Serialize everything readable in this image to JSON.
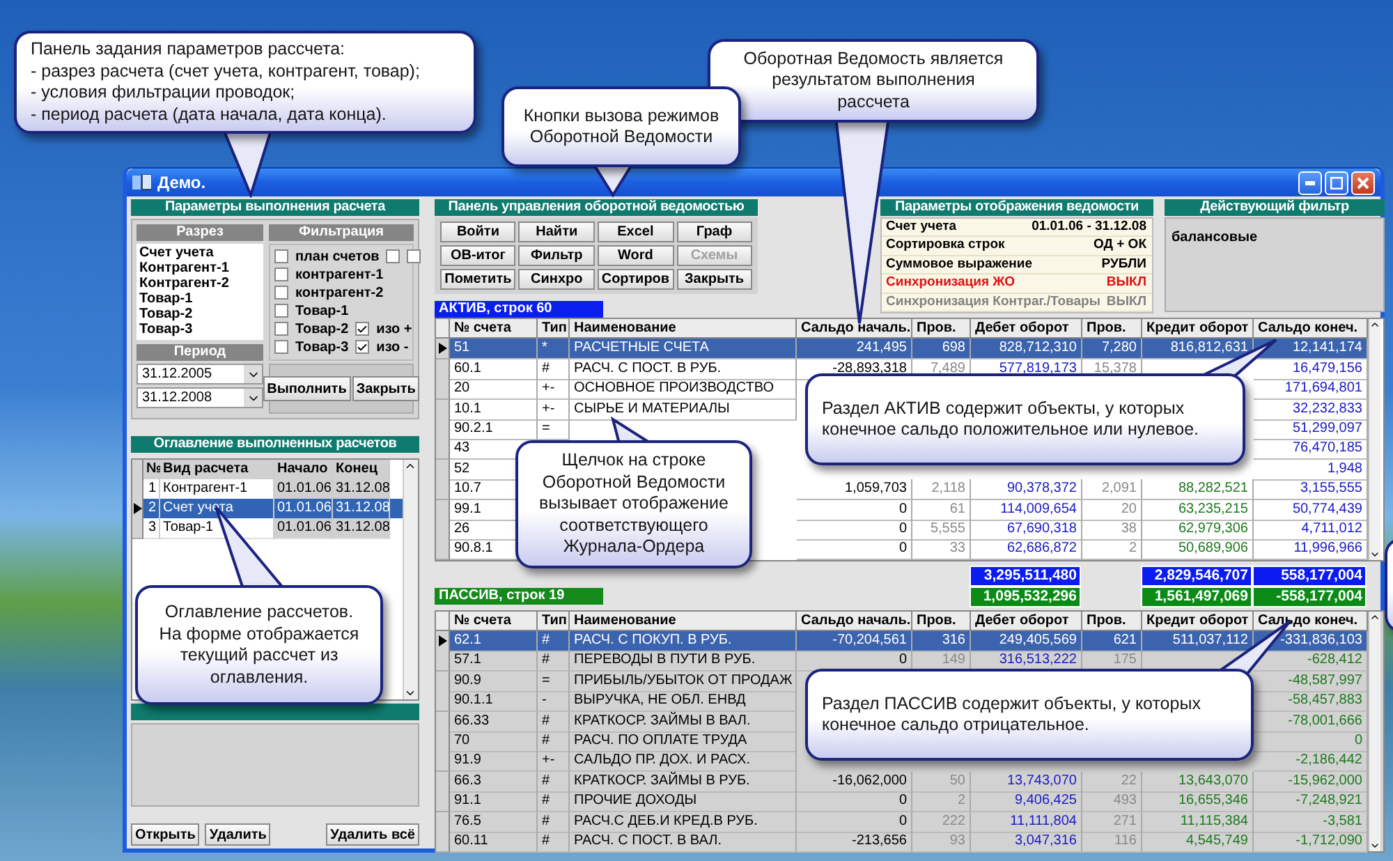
{
  "window": {
    "title": "Демо."
  },
  "calc_params": {
    "title": "Параметры выполнения расчета",
    "section": {
      "title": "Разрез",
      "items": [
        "Счет учета",
        "Контрагент-1",
        "Контрагент-2",
        "Товар-1",
        "Товар-2",
        "Товар-3"
      ]
    },
    "period": {
      "title": "Период",
      "start": "31.12.2005",
      "end": "31.12.2008"
    },
    "filter": {
      "title": "Фильтрация",
      "options": [
        {
          "label": "план счетов",
          "checked": false,
          "sub": [
            {
              "checked": false
            },
            {
              "checked": false
            }
          ]
        },
        {
          "label": "контрагент-1",
          "checked": false
        },
        {
          "label": "контрагент-2",
          "checked": false
        },
        {
          "label": "Товар-1",
          "checked": false
        },
        {
          "label": "Товар-2",
          "checked": false,
          "sub": [
            {
              "checked": true,
              "label": "изо +"
            }
          ]
        },
        {
          "label": "Товар-3",
          "checked": false,
          "sub": [
            {
              "checked": true,
              "label": "изо -"
            }
          ]
        }
      ]
    },
    "buttons": [
      "Выполнить",
      "Закрыть"
    ]
  },
  "toc": {
    "title": "Оглавление выполненных  расчетов",
    "columns": [
      "№",
      "Вид расчета",
      "Начало",
      "Конец"
    ],
    "rows": [
      {
        "cells": [
          "1",
          "Контрагент-1",
          "01.01.06",
          "31.12.08"
        ],
        "selected": false
      },
      {
        "cells": [
          "2",
          "Счет учета",
          "01.01.06",
          "31.12.08"
        ],
        "selected": true
      },
      {
        "cells": [
          "3",
          "Товар-1",
          "01.01.06",
          "31.12.08"
        ],
        "selected": false
      }
    ],
    "buttons": [
      "Открыть",
      "Удалить",
      "Удалить всё"
    ]
  },
  "control_panel": {
    "title": "Панель управления оборотной ведомостью",
    "buttons": [
      {
        "label": "Войти",
        "disabled": false
      },
      {
        "label": "Найти",
        "disabled": false
      },
      {
        "label": "Excel",
        "disabled": false
      },
      {
        "label": "Граф",
        "disabled": false
      },
      {
        "label": "ОВ-итог",
        "disabled": false
      },
      {
        "label": "Фильтр",
        "disabled": false
      },
      {
        "label": "Word",
        "disabled": false
      },
      {
        "label": "Схемы",
        "disabled": true
      },
      {
        "label": "Пометить",
        "disabled": false
      },
      {
        "label": "Синхро",
        "disabled": false
      },
      {
        "label": "Сортиров",
        "disabled": false
      },
      {
        "label": "Закрыть",
        "disabled": false
      }
    ]
  },
  "display_params": {
    "title": "Параметры отображения ведомости",
    "rows": [
      {
        "label": "Счет учета",
        "value": "01.01.06 - 31.12.08",
        "kind": "normal"
      },
      {
        "label": "Сортировка строк",
        "value": "ОД + ОК",
        "kind": "normal"
      },
      {
        "label": "Суммовое выражение",
        "value": "РУБЛИ",
        "kind": "normal"
      },
      {
        "label": "Синхронизация  ЖО",
        "value": "ВЫКЛ",
        "kind": "alert"
      },
      {
        "label": "Синхронизация Контраг./Товары",
        "value": "ВЫКЛ",
        "kind": "muted"
      }
    ]
  },
  "active_filter": {
    "title": "Действующий фильтр",
    "text": "балансовые"
  },
  "sections": [
    {
      "kind": "active",
      "label": "АКТИВ, строк 60",
      "totals": {
        "debit": "3,295,511,480",
        "credit": "2,829,546,707",
        "saldo": "558,177,004"
      },
      "columns": [
        "№ счета",
        "Тип",
        "Наименование",
        "Сальдо началь.",
        "Пров.",
        "Дебет оборот",
        "Пров.",
        "Кредит оборот",
        "Сальдо конеч."
      ],
      "rows": [
        {
          "selected": true,
          "cells": [
            "51",
            "*",
            "РАСЧЕТНЫЕ СЧЕТА",
            "241,495",
            "698",
            "828,712,310",
            "7,280",
            "816,812,631",
            "12,141,174"
          ]
        },
        {
          "selected": false,
          "cells": [
            "60.1",
            "#",
            "РАСЧ. С ПОСТ. В РУБ.",
            "-28,893,318",
            "7,489",
            "577,819,173",
            "15,378",
            null,
            "16,479,156"
          ]
        },
        {
          "selected": false,
          "cells": [
            "20",
            "+-",
            "ОСНОВНОЕ ПРОИЗВОДСТВО",
            null,
            null,
            null,
            null,
            null,
            "171,694,801"
          ]
        },
        {
          "selected": false,
          "cells": [
            "10.1",
            "+-",
            "СЫРЬЕ И МАТЕРИАЛЫ",
            null,
            null,
            null,
            null,
            null,
            "32,232,833"
          ]
        },
        {
          "selected": false,
          "cells": [
            "90.2.1",
            "=",
            null,
            null,
            null,
            null,
            null,
            null,
            "51,299,097"
          ]
        },
        {
          "selected": false,
          "cells": [
            "43",
            null,
            null,
            null,
            null,
            null,
            null,
            null,
            "76,470,185"
          ]
        },
        {
          "selected": false,
          "cells": [
            "52",
            null,
            null,
            null,
            null,
            null,
            null,
            null,
            "1,948"
          ]
        },
        {
          "selected": false,
          "cells": [
            "10.7",
            null,
            null,
            "1,059,703",
            "2,118",
            "90,378,372",
            "2,091",
            "88,282,521",
            "3,155,555"
          ]
        },
        {
          "selected": false,
          "cells": [
            "99.1",
            null,
            null,
            "0",
            "61",
            "114,009,654",
            "20",
            "63,235,215",
            "50,774,439"
          ]
        },
        {
          "selected": false,
          "cells": [
            "26",
            null,
            null,
            "0",
            "5,555",
            "67,690,318",
            "38",
            "62,979,306",
            "4,711,012"
          ]
        },
        {
          "selected": false,
          "cells": [
            "90.8.1",
            null,
            null,
            "0",
            "33",
            "62,686,872",
            "2",
            "50,689,906",
            "11,996,966"
          ]
        }
      ]
    },
    {
      "kind": "passive",
      "label": "ПАССИВ,  строк 19",
      "totals": {
        "debit": "1,095,532,296",
        "credit": "1,561,497,069",
        "saldo": "-558,177,004"
      },
      "columns": [
        "№ счета",
        "Тип",
        "Наименование",
        "Сальдо началь.",
        "Пров.",
        "Дебет оборот",
        "Пров.",
        "Кредит оборот",
        "Сальдо конеч."
      ],
      "rows": [
        {
          "selected": true,
          "cells": [
            "62.1",
            "#",
            "РАСЧ. С ПОКУП. В РУБ.",
            "-70,204,561",
            "316",
            "249,405,569",
            "621",
            "511,037,112",
            "-331,836,103"
          ]
        },
        {
          "selected": false,
          "cells": [
            "57.1",
            "#",
            "ПЕРЕВОДЫ В ПУТИ В РУБ.",
            "0",
            "149",
            "316,513,222",
            "175",
            null,
            "-628,412"
          ]
        },
        {
          "selected": false,
          "cells": [
            "90.9",
            "=",
            "ПРИБЫЛЬ/УБЫТОК ОТ ПРОДАЖ",
            null,
            null,
            null,
            null,
            null,
            "-48,587,997"
          ]
        },
        {
          "selected": false,
          "cells": [
            "90.1.1",
            "-",
            "ВЫРУЧКА, НЕ ОБЛ. ЕНВД",
            null,
            null,
            null,
            null,
            null,
            "-58,457,883"
          ]
        },
        {
          "selected": false,
          "cells": [
            "66.33",
            "#",
            "КРАТКОСР. ЗАЙМЫ В ВАЛ.",
            null,
            null,
            null,
            null,
            null,
            "-78,001,666"
          ]
        },
        {
          "selected": false,
          "cells": [
            "70",
            "#",
            "РАСЧ. ПО ОПЛАТЕ ТРУДА",
            null,
            null,
            null,
            null,
            null,
            "0"
          ]
        },
        {
          "selected": false,
          "cells": [
            "91.9",
            "+-",
            "САЛЬДО ПР. ДОХ. И РАСХ.",
            null,
            null,
            null,
            null,
            null,
            "-2,186,442"
          ]
        },
        {
          "selected": false,
          "cells": [
            "66.3",
            "#",
            "КРАТКОСР. ЗАЙМЫ В РУБ.",
            "-16,062,000",
            "50",
            "13,743,070",
            "22",
            "13,643,070",
            "-15,962,000"
          ]
        },
        {
          "selected": false,
          "cells": [
            "91.1",
            "#",
            "ПРОЧИЕ ДОХОДЫ",
            "0",
            "2",
            "9,406,425",
            "493",
            "16,655,346",
            "-7,248,921"
          ]
        },
        {
          "selected": false,
          "cells": [
            "76.5",
            "#",
            "РАСЧ.С  ДЕБ.И КРЕД.В РУБ.",
            "0",
            "222",
            "11,111,804",
            "271",
            "11,115,384",
            "-3,581"
          ]
        },
        {
          "selected": false,
          "cells": [
            "60.11",
            "#",
            "РАСЧ. С ПОСТ. В ВАЛ.",
            "-213,656",
            "93",
            "3,047,316",
            "116",
            "4,545,749",
            "-1,712,090"
          ]
        }
      ]
    }
  ],
  "callouts": [
    {
      "lines": [
        "Панель задания параметров рассчета:",
        "- разрез расчета (счет учета, контрагент, товар);",
        "- условия фильтрации проводок;",
        "- период расчета (дата начала, дата конца)."
      ]
    },
    {
      "lines": [
        "Кнопки вызова режимов",
        "Оборотной Ведомости"
      ]
    },
    {
      "lines": [
        "Оборотная Ведомость является",
        "результатом выполнения",
        "рассчета"
      ]
    },
    {
      "lines": [
        "Раздел АКТИВ содержит объекты, у которых",
        "конечное сальдо положительное или нулевое."
      ]
    },
    {
      "lines": [
        "Щелчок на строке",
        "Оборотной Ведомости",
        "вызывает отображение",
        "соответствующего",
        "Журнала-Ордера"
      ]
    },
    {
      "lines": [
        "Оглавление рассчетов.",
        "На форме отображается",
        "текущий рассчет из",
        "оглавления."
      ]
    },
    {
      "lines": [
        "Раздел ПАССИВ содержит объекты, у которых",
        "конечное сальдо отрицательное."
      ]
    }
  ]
}
